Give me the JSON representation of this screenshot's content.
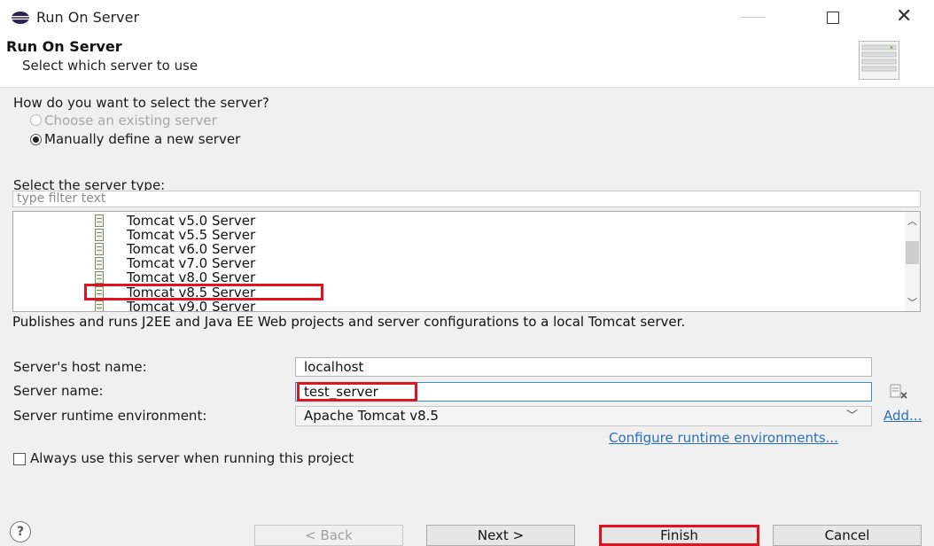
{
  "window": {
    "title": "Run On Server"
  },
  "banner": {
    "title": "Run On Server",
    "subtitle": "Select which server to use"
  },
  "selection": {
    "question": "How do you want to select the server?",
    "option_existing": "Choose an existing server",
    "option_manual": "Manually define a new server",
    "selected": "option_manual"
  },
  "server_type": {
    "label": "Select the server type:",
    "filter_placeholder": "type filter text",
    "items": [
      {
        "label": "Tomcat v5.0 Server"
      },
      {
        "label": "Tomcat v5.5 Server"
      },
      {
        "label": "Tomcat v6.0 Server"
      },
      {
        "label": "Tomcat v7.0 Server"
      },
      {
        "label": "Tomcat v8.0 Server"
      },
      {
        "label": "Tomcat v8.5 Server"
      },
      {
        "label": "Tomcat v9.0 Server"
      }
    ],
    "selected": "Tomcat v8.5 Server"
  },
  "description": "Publishes and runs J2EE and Java EE Web projects and server configurations to a local Tomcat server.",
  "fields": {
    "host_label": "Server's host name:",
    "host_value": "localhost",
    "name_label": "Server name:",
    "name_value": "test_server",
    "runtime_label": "Server runtime environment:",
    "runtime_value": "Apache Tomcat v8.5",
    "add_link": "Add...",
    "configure_link": "Configure runtime environments..."
  },
  "always_use": {
    "label": "Always use this server when running this project",
    "checked": false
  },
  "buttons": {
    "help": "?",
    "back": "< Back",
    "next": "Next >",
    "finish": "Finish",
    "cancel": "Cancel"
  },
  "colors": {
    "highlight": "#e0141e",
    "link": "#2b6fc0",
    "focus_border": "#3a8bd6"
  },
  "icons": [
    "eclipse-icon",
    "minimize-icon",
    "maximize-icon",
    "close-icon",
    "server-illustration-icon",
    "server-item-icon",
    "chevron-up-icon",
    "chevron-down-icon",
    "edit-server-name-icon",
    "help-icon"
  ]
}
